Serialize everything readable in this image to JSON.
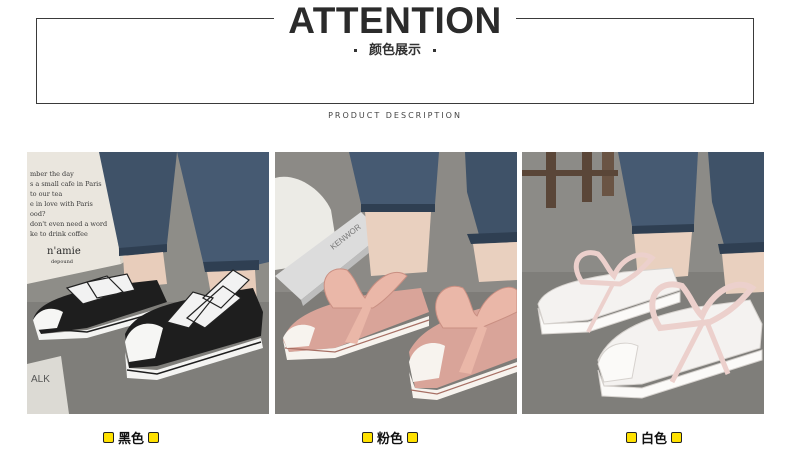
{
  "header": {
    "title": "ATTENTION",
    "subtitle": "颜色展示",
    "description": "PRODUCT DESCRIPTION"
  },
  "photos": [
    {
      "color_label": "黑色",
      "shoe_color": "#1e1e1e",
      "lace_color": "#f2f2f2",
      "bag_text": [
        "mber the day",
        "s a small cafe in Paris",
        "to our tea",
        "e in love with Paris",
        "ood?",
        "don't even need a word",
        "ke to drink coffee",
        "n'amie",
        "depound"
      ],
      "floor_text": "ALK"
    },
    {
      "color_label": "粉色",
      "shoe_color": "#d9a499",
      "lace_color": "#eab7a8",
      "book_text": "KENWOR"
    },
    {
      "color_label": "白色",
      "shoe_color": "#f4f2f0",
      "lace_color": "#ecd0cc"
    }
  ],
  "colors": {
    "label_square": "#ffe100",
    "border": "#3a3a3a"
  }
}
